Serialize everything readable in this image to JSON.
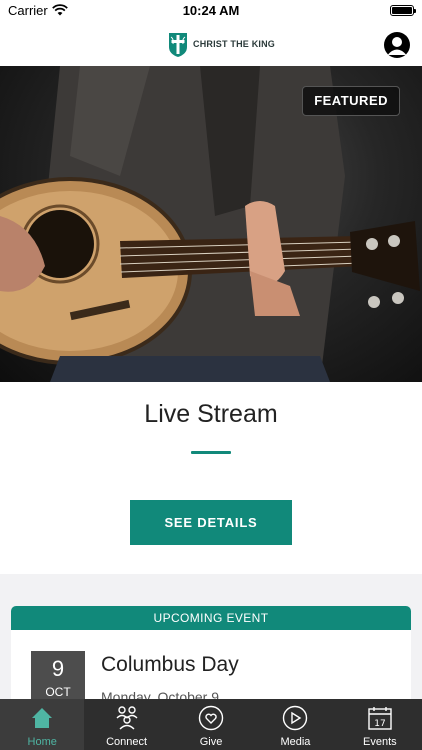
{
  "status_bar": {
    "carrier": "Carrier",
    "time": "10:24 AM"
  },
  "header": {
    "logo_text": "CHRIST THE KING"
  },
  "featured_card": {
    "badge": "FEATURED",
    "title": "Live Stream",
    "button_label": "SEE DETAILS"
  },
  "upcoming_event": {
    "header": "UPCOMING EVENT",
    "day": "9",
    "month": "OCT",
    "name": "Columbus Day",
    "date_text": "Monday, October 9"
  },
  "tabs": [
    {
      "label": "Home",
      "icon": "home-icon",
      "active": true
    },
    {
      "label": "Connect",
      "icon": "people-icon",
      "active": false
    },
    {
      "label": "Give",
      "icon": "heart-icon",
      "active": false
    },
    {
      "label": "Media",
      "icon": "play-icon",
      "active": false
    },
    {
      "label": "Events",
      "icon": "calendar-icon",
      "active": false
    }
  ],
  "colors": {
    "accent": "#11897a",
    "tab_active": "#4fb5a3",
    "tab_bar": "#2e2e2e"
  }
}
